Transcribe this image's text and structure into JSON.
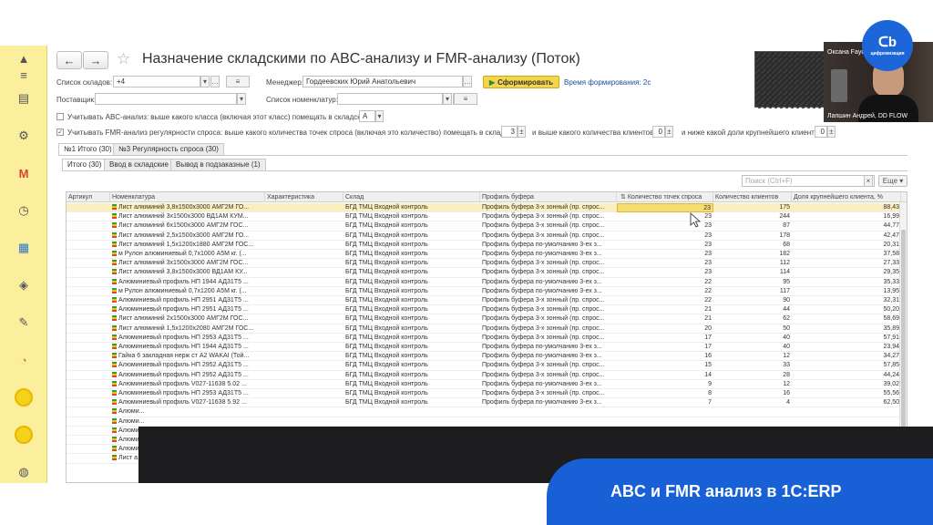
{
  "window": {
    "title": "Назначение складскими по ABC-анализу и FMR-анализу (Поток)",
    "back_icon": "arrow-left-icon",
    "forward_icon": "arrow-right-icon",
    "favorite_icon": "star-icon"
  },
  "filters": {
    "warehouses_label": "Список складов:",
    "warehouses_value": "+4",
    "manager_label": "Менеджер:",
    "manager_value": "Гордеевских Юрий Анатольевич",
    "generate_button": "Сформировать",
    "generation_time": "Время формирования: 2с",
    "supplier_label": "Поставщик:",
    "supplier_value": "",
    "nomenclature_label": "Список номенклатур:",
    "nomenclature_value": "",
    "menu_button": "≡"
  },
  "options": {
    "abc_label": "Учитывать ABC-анализ: выше какого класса (включая этот класс) помещать в складские:",
    "abc_checked": false,
    "abc_class": "A",
    "fmr_label": "Учитывать FMR-анализ регулярности спроса: выше какого количества точек спроса (включая это количество) помещать в складские:",
    "fmr_checked": true,
    "fmr_points": "3",
    "clients_label": "и выше какого количества клиентов:",
    "clients_value": "0",
    "share_label": "и ниже какой доли крупнейшего клиента:",
    "share_value": "0"
  },
  "tabs_top": [
    "№1 Итого (30)",
    "№3 Регулярность спроса (30)"
  ],
  "tabs_sub": [
    "Итого (30)",
    "Ввод в складские",
    "Вывод в подзаказные (1)"
  ],
  "search": {
    "placeholder": "Поиск (Ctrl+F)",
    "more_button": "Еще"
  },
  "table": {
    "headers": [
      "Артикул",
      "Номенклатура",
      "Характеристика",
      "Склад",
      "Профиль буфера",
      "Количество точек спроса",
      "Количество клиентов",
      "Доля крупнейшего клиента, %"
    ],
    "rows": [
      {
        "name": "Лист алюминий 3,8х1500х3000 АМГ2М ГО...",
        "warehouse": "БГД ТМЦ Входной контроль",
        "profile": "Профиль буфера 3-х зонный (пр. спрос...",
        "points": "23",
        "clients": "175",
        "share": "88,43"
      },
      {
        "name": "Лист алюминий 3х1500х3000 ВД1АМ КУМ...",
        "warehouse": "БГД ТМЦ Входной контроль",
        "profile": "Профиль буфера 3-х зонный (пр. спрос...",
        "points": "23",
        "clients": "244",
        "share": "16,99"
      },
      {
        "name": "Лист алюминий 6х1500х3000 АМГ2М ГОС...",
        "warehouse": "БГД ТМЦ Входной контроль",
        "profile": "Профиль буфера 3-х зонный (пр. спрос...",
        "points": "23",
        "clients": "87",
        "share": "44,77"
      },
      {
        "name": "Лист алюминий 2,5х1500х3000 АМГ2М ГО...",
        "warehouse": "БГД ТМЦ Входной контроль",
        "profile": "Профиль буфера 3-х зонный (пр. спрос...",
        "points": "23",
        "clients": "178",
        "share": "42,47"
      },
      {
        "name": "Лист алюминий 1,5х1200х1880 АМГ2М ГОС...",
        "warehouse": "БГД ТМЦ Входной контроль",
        "profile": "Профиль буфера по-умолчанию 3-ех з...",
        "points": "23",
        "clients": "68",
        "share": "20,31"
      },
      {
        "name": "м Рулон алюминиевый 0,7х1000 А5М кг. (...",
        "warehouse": "БГД ТМЦ Входной контроль",
        "profile": "Профиль буфера по-умолчанию 3-ех з...",
        "points": "23",
        "clients": "182",
        "share": "37,58"
      },
      {
        "name": "Лист алюминий 3х1500х3000 АМГ2М ГОС...",
        "warehouse": "БГД ТМЦ Входной контроль",
        "profile": "Профиль буфера 3-х зонный (пр. спрос...",
        "points": "23",
        "clients": "112",
        "share": "27,33"
      },
      {
        "name": "Лист алюминий 3,8х1500х3000 ВД1АМ КУ...",
        "warehouse": "БГД ТМЦ Входной контроль",
        "profile": "Профиль буфера 3-х зонный (пр. спрос...",
        "points": "23",
        "clients": "114",
        "share": "29,35"
      },
      {
        "name": "Алюминиевый профиль НП 1944 АД31Т5 ...",
        "warehouse": "БГД ТМЦ Входной контроль",
        "profile": "Профиль буфера по-умолчанию 3-ех з...",
        "points": "22",
        "clients": "95",
        "share": "35,33"
      },
      {
        "name": "м Рулон алюминиевый 0,7х1200 А5М кг. (...",
        "warehouse": "БГД ТМЦ Входной контроль",
        "profile": "Профиль буфера по-умолчанию 3-ех з...",
        "points": "22",
        "clients": "117",
        "share": "13,95"
      },
      {
        "name": "Алюминиевый профиль НП 2951 АД31Т5 ...",
        "warehouse": "БГД ТМЦ Входной контроль",
        "profile": "Профиль буфера 3-х зонный (пр. спрос...",
        "points": "22",
        "clients": "90",
        "share": "32,31"
      },
      {
        "name": "Алюминиевый профиль НП 2951 АД31Т5 ...",
        "warehouse": "БГД ТМЦ Входной контроль",
        "profile": "Профиль буфера 3-х зонный (пр. спрос...",
        "points": "21",
        "clients": "44",
        "share": "50,20"
      },
      {
        "name": "Лист алюминий 2х1500х3000 АМГ2М ГОС...",
        "warehouse": "БГД ТМЦ Входной контроль",
        "profile": "Профиль буфера 3-х зонный (пр. спрос...",
        "points": "21",
        "clients": "62",
        "share": "58,69"
      },
      {
        "name": "Лист алюминий 1,5х1200х2080 АМГ2М ГОС...",
        "warehouse": "БГД ТМЦ Входной контроль",
        "profile": "Профиль буфера 3-х зонный (пр. спрос...",
        "points": "20",
        "clients": "50",
        "share": "35,89"
      },
      {
        "name": "Алюминиевый профиль НП 2953 АД31Т5 ...",
        "warehouse": "БГД ТМЦ Входной контроль",
        "profile": "Профиль буфера 3-х зонный (пр. спрос...",
        "points": "17",
        "clients": "40",
        "share": "57,91"
      },
      {
        "name": "Алюминиевый профиль НП 1944 АД31Т5 ...",
        "warehouse": "БГД ТМЦ Входной контроль",
        "profile": "Профиль буфера по-умолчанию 3-ех з...",
        "points": "17",
        "clients": "40",
        "share": "23,94"
      },
      {
        "name": "Гайка 6 закладная нерж ст А2 WAKAI (Той...",
        "warehouse": "БГД ТМЦ Входной контроль",
        "profile": "Профиль буфера по-умолчанию 3-ех з...",
        "points": "16",
        "clients": "12",
        "share": "34,27"
      },
      {
        "name": "Алюминиевый профиль НП 2952 АД31Т5 ...",
        "warehouse": "БГД ТМЦ Входной контроль",
        "profile": "Профиль буфера 3-х зонный (пр. спрос...",
        "points": "15",
        "clients": "33",
        "share": "57,85"
      },
      {
        "name": "Алюминиевый профиль НП 2952 АД31Т5 ...",
        "warehouse": "БГД ТМЦ Входной контроль",
        "profile": "Профиль буфера 3-х зонный (пр. спрос...",
        "points": "14",
        "clients": "28",
        "share": "44,24"
      },
      {
        "name": "Алюминиевый профиль V027-11638 5.02 ...",
        "warehouse": "БГД ТМЦ Входной контроль",
        "profile": "Профиль буфера по-умолчанию 3-ех з...",
        "points": "9",
        "clients": "12",
        "share": "39,02"
      },
      {
        "name": "Алюминиевый профиль НП 2953 АД31Т5 ...",
        "warehouse": "БГД ТМЦ Входной контроль",
        "profile": "Профиль буфера 3-х зонный (пр. спрос...",
        "points": "8",
        "clients": "16",
        "share": "55,56"
      },
      {
        "name": "Алюминиевый профиль V027-11638 5.92 ...",
        "warehouse": "БГД ТМЦ Входной контроль",
        "profile": "Профиль буфера по-умолчанию 3-ех з...",
        "points": "7",
        "clients": "4",
        "share": "62,50"
      },
      {
        "name": "Алюми...",
        "warehouse": "",
        "profile": "",
        "points": "",
        "clients": "",
        "share": ""
      },
      {
        "name": "Алюми...",
        "warehouse": "",
        "profile": "",
        "points": "",
        "clients": "",
        "share": ""
      },
      {
        "name": "Алюми...",
        "warehouse": "",
        "profile": "",
        "points": "",
        "clients": "",
        "share": ""
      },
      {
        "name": "Алюми...",
        "warehouse": "",
        "profile": "",
        "points": "",
        "clients": "",
        "share": ""
      },
      {
        "name": "Алюми...",
        "warehouse": "",
        "profile": "",
        "points": "",
        "clients": "",
        "share": ""
      },
      {
        "name": "Лист а...",
        "warehouse": "",
        "profile": "",
        "points": "",
        "clients": "",
        "share": ""
      }
    ]
  },
  "webcam": {
    "name_top": "Оксана Fayd",
    "name_bottom": "Лапшин Андрей, DD FLOW"
  },
  "logo": {
    "text": "цифровизация"
  },
  "banner": {
    "text": "ABC и FMR анализ в 1C:ERP"
  },
  "sidebar_icons": [
    "chevron-up-icon",
    "menu-icon",
    "document-icon",
    "gear-icon",
    "gmail-icon",
    "clock-icon",
    "calendar-icon",
    "box-icon",
    "wrench-icon",
    "chart-icon",
    "coin-icon",
    "coin-icon",
    "globe-icon"
  ],
  "colors": {
    "sidebar": "#fbee9d",
    "selected_row": "#fbeec0",
    "accent": "#f5d648",
    "banner": "#1760d6"
  }
}
